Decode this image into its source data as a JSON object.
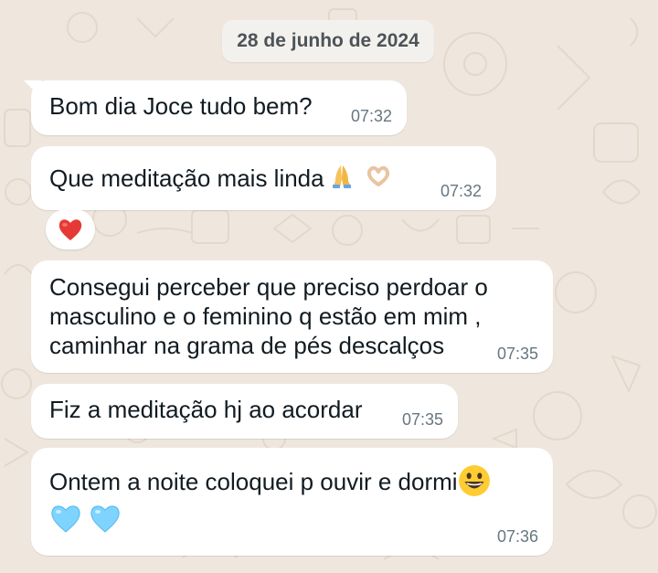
{
  "chat": {
    "date": "28 de junho de 2024",
    "messages": [
      {
        "text": "Bom dia Joce tudo bem?",
        "time": "07:32"
      },
      {
        "text": "Que meditação mais linda",
        "time": "07:32",
        "emojis": [
          "folded-hands",
          "heart-hands"
        ],
        "reaction": "red-heart"
      },
      {
        "text_lines": [
          "Consegui perceber que preciso perdoar o",
          "masculino e o feminino q estão em mim ,",
          "caminhar na grama de pés descalços"
        ],
        "time": "07:35"
      },
      {
        "text": "Fiz a meditação hj ao acordar",
        "time": "07:35"
      },
      {
        "text": "Ontem a noite coloquei p ouvir e dormi",
        "time": "07:36",
        "emojis": [
          "grinning-face",
          "light-blue-heart",
          "light-blue-heart"
        ]
      }
    ]
  },
  "colors": {
    "background": "#efe7de",
    "bubble": "#ffffff",
    "date_chip": "#f3f1ee",
    "timestamp": "#667781",
    "text": "#111b21",
    "reaction_heart": "#e53935",
    "blue_heart": "#7fd3ff"
  }
}
